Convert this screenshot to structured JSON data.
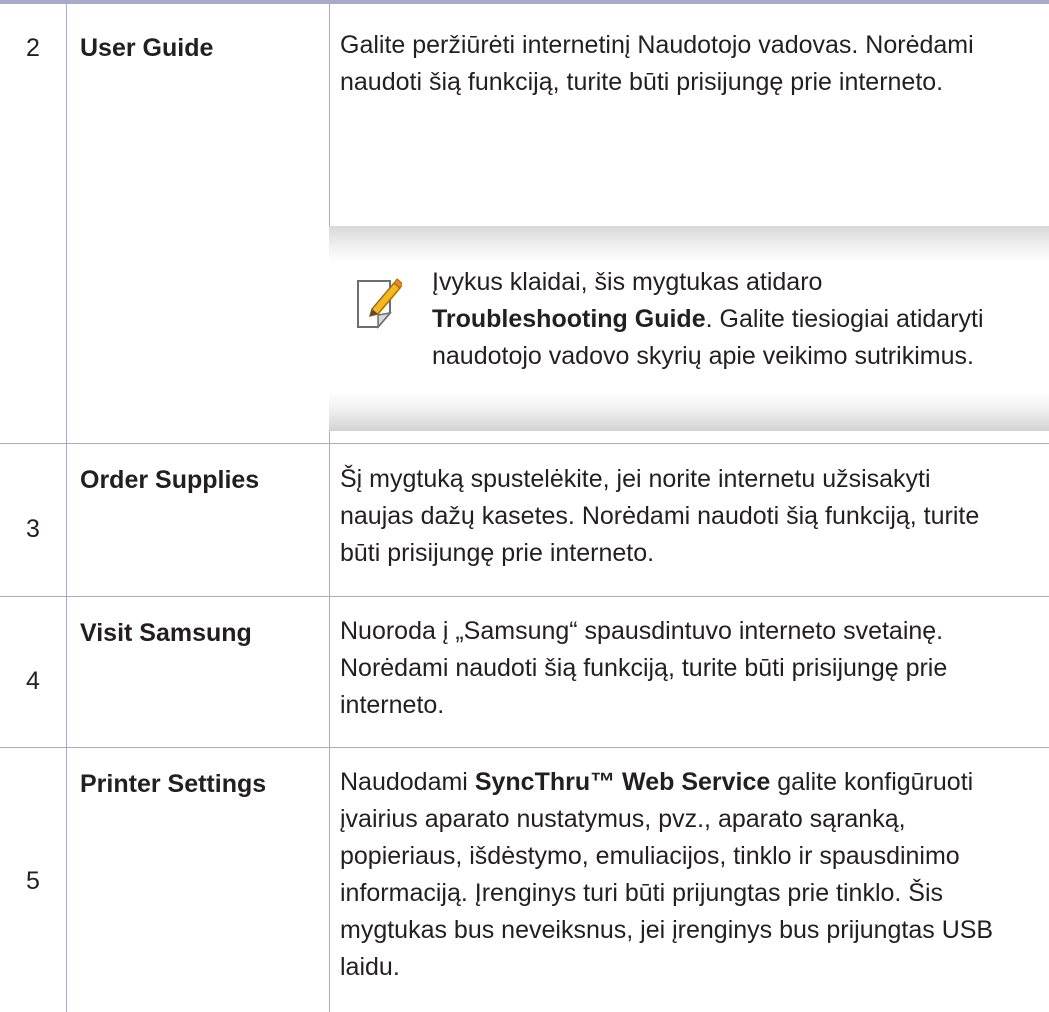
{
  "rows": [
    {
      "number": "2",
      "name": "User Guide",
      "description": "Galite peržiūrėti internetinį Naudotojo vadovas. Norėdami naudoti šią funkciją, turite būti prisijungę prie interneto.",
      "note": {
        "icon": "note-pencil-icon",
        "text_before": "Įvykus klaidai, šis mygtukas atidaro ",
        "bold": "Troubleshooting Guide",
        "text_after": ". Galite tiesiogiai atidaryti naudotojo vadovo skyrių apie veikimo sutrikimus."
      }
    },
    {
      "number": "3",
      "name": "Order Supplies",
      "description": "Šį mygtuką spustelėkite, jei norite internetu užsisakyti naujas dažų kasetes. Norėdami naudoti šią funkciją, turite būti prisijungę prie interneto."
    },
    {
      "number": "4",
      "name": "Visit Samsung",
      "description": "Nuoroda į „Samsung“ spausdintuvo interneto svetainę. Norėdami naudoti šią funkciją, turite būti prisijungę prie interneto."
    },
    {
      "number": "5",
      "name": "Printer Settings",
      "description_before": "Naudodami ",
      "description_bold": "SyncThru™ Web Service",
      "description_after": " galite konfigūruoti įvairius aparato nustatymus, pvz., aparato sąranką, popieriaus, išdėstymo, emuliacijos, tinklo ir spausdinimo informaciją. Įrenginys turi būti prijungtas prie tinklo. Šis mygtukas bus neveiksnus, jei įrenginys bus prijungtas USB laidu."
    }
  ],
  "colors": {
    "rule": "#a9a9c8",
    "text": "#231f20",
    "note_shade": "#d8d8d8"
  }
}
